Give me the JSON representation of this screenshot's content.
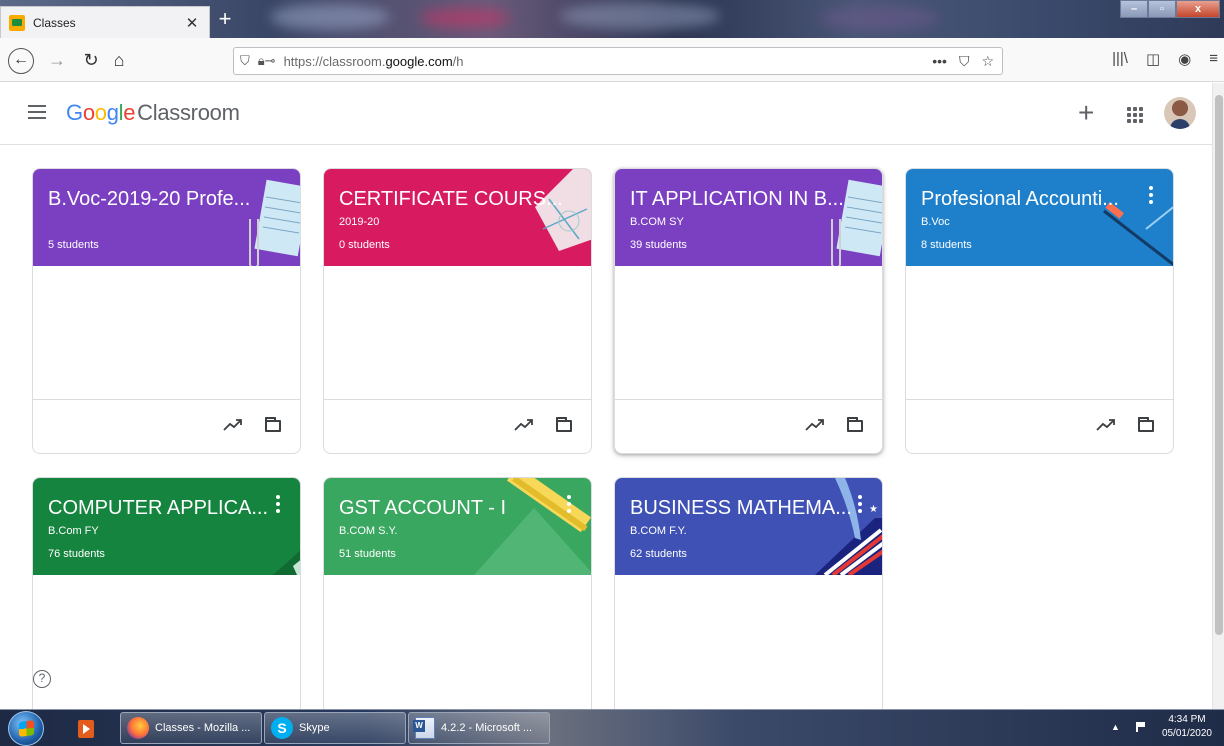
{
  "browser": {
    "tab_title": "Classes",
    "url_prefix": "https://classroom.",
    "url_host": "google.com",
    "url_path": "/h"
  },
  "header": {
    "logo_google_letters": [
      "G",
      "o",
      "o",
      "g",
      "l",
      "e"
    ],
    "logo_product": "Classroom"
  },
  "classes": [
    {
      "name": "B.Voc-2019-20 Profe...",
      "section": "",
      "students": "5 students",
      "color": "#7b3fc2"
    },
    {
      "name": "CERTIFICATE COURS...",
      "section": "2019-20",
      "students": "0 students",
      "color": "#d81b60"
    },
    {
      "name": "IT APPLICATION IN B...",
      "section": "B.COM SY",
      "students": "39 students",
      "color": "#7b3fc2"
    },
    {
      "name": "Profesional Accounti...",
      "section": "B.Voc",
      "students": "8 students",
      "color": "#1e7fcb"
    },
    {
      "name": "COMPUTER APPLICA...",
      "section": "B.Com FY",
      "students": "76 students",
      "color": "#15843f"
    },
    {
      "name": "GST ACCOUNT - I",
      "section": "B.COM S.Y.",
      "students": "51 students",
      "color": "#3aa760"
    },
    {
      "name": "BUSINESS MATHEMA...",
      "section": "B.COM F.Y.",
      "students": "62 students",
      "color": "#3f51b5"
    }
  ],
  "taskbar": {
    "items": [
      {
        "label": "Classes - Mozilla ...",
        "icon": "firefox-icon"
      },
      {
        "label": "Skype",
        "icon": "skype-icon"
      },
      {
        "label": "4.2.2 - Microsoft ...",
        "icon": "word-icon"
      }
    ],
    "time": "4:34 PM",
    "date": "05/01/2020"
  }
}
